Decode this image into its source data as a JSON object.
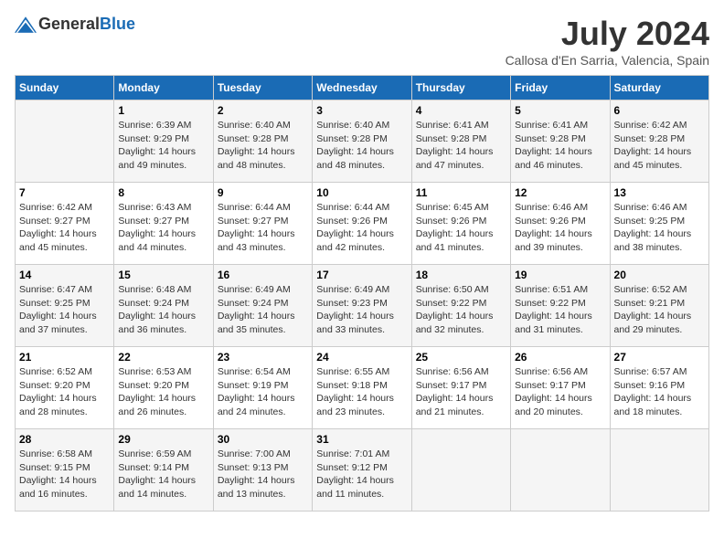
{
  "header": {
    "logo_general": "General",
    "logo_blue": "Blue",
    "month_title": "July 2024",
    "location": "Callosa d'En Sarria, Valencia, Spain"
  },
  "days_of_week": [
    "Sunday",
    "Monday",
    "Tuesday",
    "Wednesday",
    "Thursday",
    "Friday",
    "Saturday"
  ],
  "weeks": [
    [
      {
        "day": "",
        "content": ""
      },
      {
        "day": "1",
        "content": "Sunrise: 6:39 AM\nSunset: 9:29 PM\nDaylight: 14 hours\nand 49 minutes."
      },
      {
        "day": "2",
        "content": "Sunrise: 6:40 AM\nSunset: 9:28 PM\nDaylight: 14 hours\nand 48 minutes."
      },
      {
        "day": "3",
        "content": "Sunrise: 6:40 AM\nSunset: 9:28 PM\nDaylight: 14 hours\nand 48 minutes."
      },
      {
        "day": "4",
        "content": "Sunrise: 6:41 AM\nSunset: 9:28 PM\nDaylight: 14 hours\nand 47 minutes."
      },
      {
        "day": "5",
        "content": "Sunrise: 6:41 AM\nSunset: 9:28 PM\nDaylight: 14 hours\nand 46 minutes."
      },
      {
        "day": "6",
        "content": "Sunrise: 6:42 AM\nSunset: 9:28 PM\nDaylight: 14 hours\nand 45 minutes."
      }
    ],
    [
      {
        "day": "7",
        "content": "Sunrise: 6:42 AM\nSunset: 9:27 PM\nDaylight: 14 hours\nand 45 minutes."
      },
      {
        "day": "8",
        "content": "Sunrise: 6:43 AM\nSunset: 9:27 PM\nDaylight: 14 hours\nand 44 minutes."
      },
      {
        "day": "9",
        "content": "Sunrise: 6:44 AM\nSunset: 9:27 PM\nDaylight: 14 hours\nand 43 minutes."
      },
      {
        "day": "10",
        "content": "Sunrise: 6:44 AM\nSunset: 9:26 PM\nDaylight: 14 hours\nand 42 minutes."
      },
      {
        "day": "11",
        "content": "Sunrise: 6:45 AM\nSunset: 9:26 PM\nDaylight: 14 hours\nand 41 minutes."
      },
      {
        "day": "12",
        "content": "Sunrise: 6:46 AM\nSunset: 9:26 PM\nDaylight: 14 hours\nand 39 minutes."
      },
      {
        "day": "13",
        "content": "Sunrise: 6:46 AM\nSunset: 9:25 PM\nDaylight: 14 hours\nand 38 minutes."
      }
    ],
    [
      {
        "day": "14",
        "content": "Sunrise: 6:47 AM\nSunset: 9:25 PM\nDaylight: 14 hours\nand 37 minutes."
      },
      {
        "day": "15",
        "content": "Sunrise: 6:48 AM\nSunset: 9:24 PM\nDaylight: 14 hours\nand 36 minutes."
      },
      {
        "day": "16",
        "content": "Sunrise: 6:49 AM\nSunset: 9:24 PM\nDaylight: 14 hours\nand 35 minutes."
      },
      {
        "day": "17",
        "content": "Sunrise: 6:49 AM\nSunset: 9:23 PM\nDaylight: 14 hours\nand 33 minutes."
      },
      {
        "day": "18",
        "content": "Sunrise: 6:50 AM\nSunset: 9:22 PM\nDaylight: 14 hours\nand 32 minutes."
      },
      {
        "day": "19",
        "content": "Sunrise: 6:51 AM\nSunset: 9:22 PM\nDaylight: 14 hours\nand 31 minutes."
      },
      {
        "day": "20",
        "content": "Sunrise: 6:52 AM\nSunset: 9:21 PM\nDaylight: 14 hours\nand 29 minutes."
      }
    ],
    [
      {
        "day": "21",
        "content": "Sunrise: 6:52 AM\nSunset: 9:20 PM\nDaylight: 14 hours\nand 28 minutes."
      },
      {
        "day": "22",
        "content": "Sunrise: 6:53 AM\nSunset: 9:20 PM\nDaylight: 14 hours\nand 26 minutes."
      },
      {
        "day": "23",
        "content": "Sunrise: 6:54 AM\nSunset: 9:19 PM\nDaylight: 14 hours\nand 24 minutes."
      },
      {
        "day": "24",
        "content": "Sunrise: 6:55 AM\nSunset: 9:18 PM\nDaylight: 14 hours\nand 23 minutes."
      },
      {
        "day": "25",
        "content": "Sunrise: 6:56 AM\nSunset: 9:17 PM\nDaylight: 14 hours\nand 21 minutes."
      },
      {
        "day": "26",
        "content": "Sunrise: 6:56 AM\nSunset: 9:17 PM\nDaylight: 14 hours\nand 20 minutes."
      },
      {
        "day": "27",
        "content": "Sunrise: 6:57 AM\nSunset: 9:16 PM\nDaylight: 14 hours\nand 18 minutes."
      }
    ],
    [
      {
        "day": "28",
        "content": "Sunrise: 6:58 AM\nSunset: 9:15 PM\nDaylight: 14 hours\nand 16 minutes."
      },
      {
        "day": "29",
        "content": "Sunrise: 6:59 AM\nSunset: 9:14 PM\nDaylight: 14 hours\nand 14 minutes."
      },
      {
        "day": "30",
        "content": "Sunrise: 7:00 AM\nSunset: 9:13 PM\nDaylight: 14 hours\nand 13 minutes."
      },
      {
        "day": "31",
        "content": "Sunrise: 7:01 AM\nSunset: 9:12 PM\nDaylight: 14 hours\nand 11 minutes."
      },
      {
        "day": "",
        "content": ""
      },
      {
        "day": "",
        "content": ""
      },
      {
        "day": "",
        "content": ""
      }
    ]
  ]
}
